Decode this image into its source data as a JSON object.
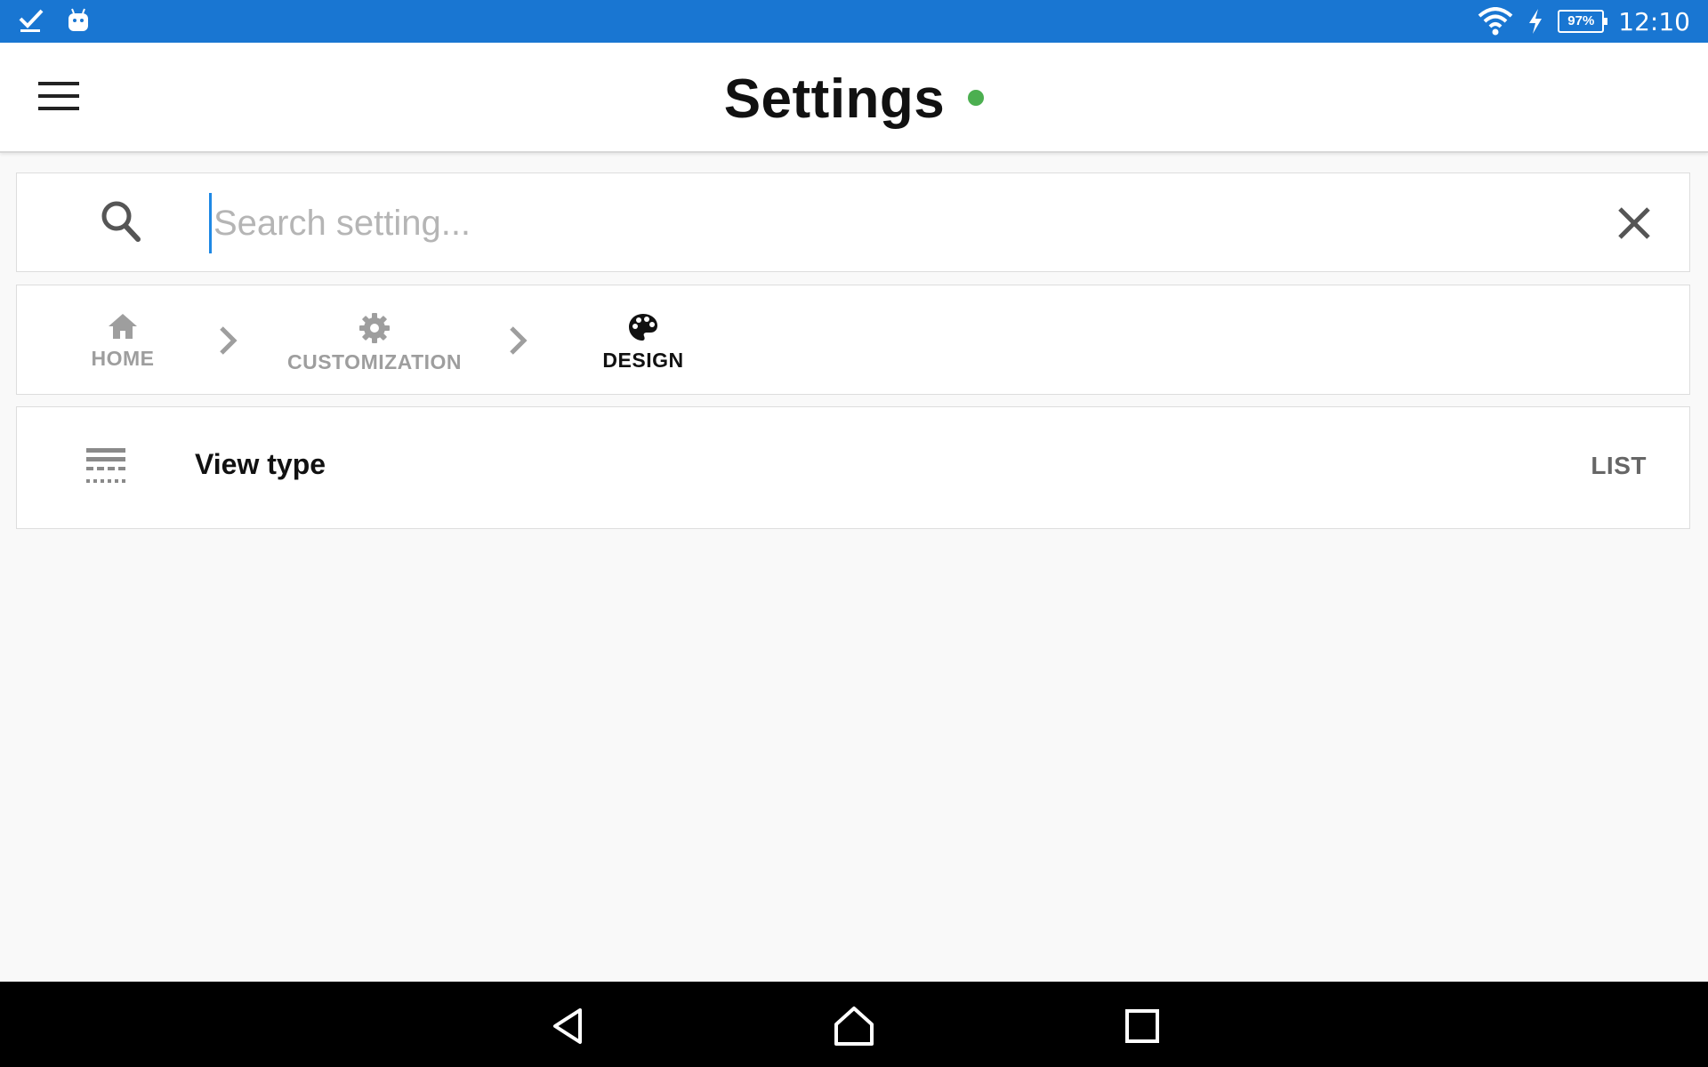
{
  "status_bar": {
    "notification_icons": [
      "checkmark-download-icon",
      "android-icon"
    ],
    "battery_percent": "97%",
    "battery_level": 0.97,
    "time": "12:10",
    "color": "#1976d2"
  },
  "app_bar": {
    "title": "Settings",
    "status_dot_color": "#4caf50"
  },
  "search": {
    "placeholder": "Search setting...",
    "value": ""
  },
  "breadcrumb": {
    "items": [
      {
        "label": "HOME",
        "icon": "home-icon",
        "active": false
      },
      {
        "label": "CUSTOMIZATION",
        "icon": "gear-icon",
        "active": false
      },
      {
        "label": "DESIGN",
        "icon": "palette-icon",
        "active": true
      }
    ]
  },
  "settings": {
    "items": [
      {
        "icon": "view-type-icon",
        "title": "View type",
        "value": "LIST"
      }
    ]
  },
  "nav_bar": {
    "buttons": [
      "back-icon",
      "home-icon",
      "recents-icon"
    ]
  }
}
